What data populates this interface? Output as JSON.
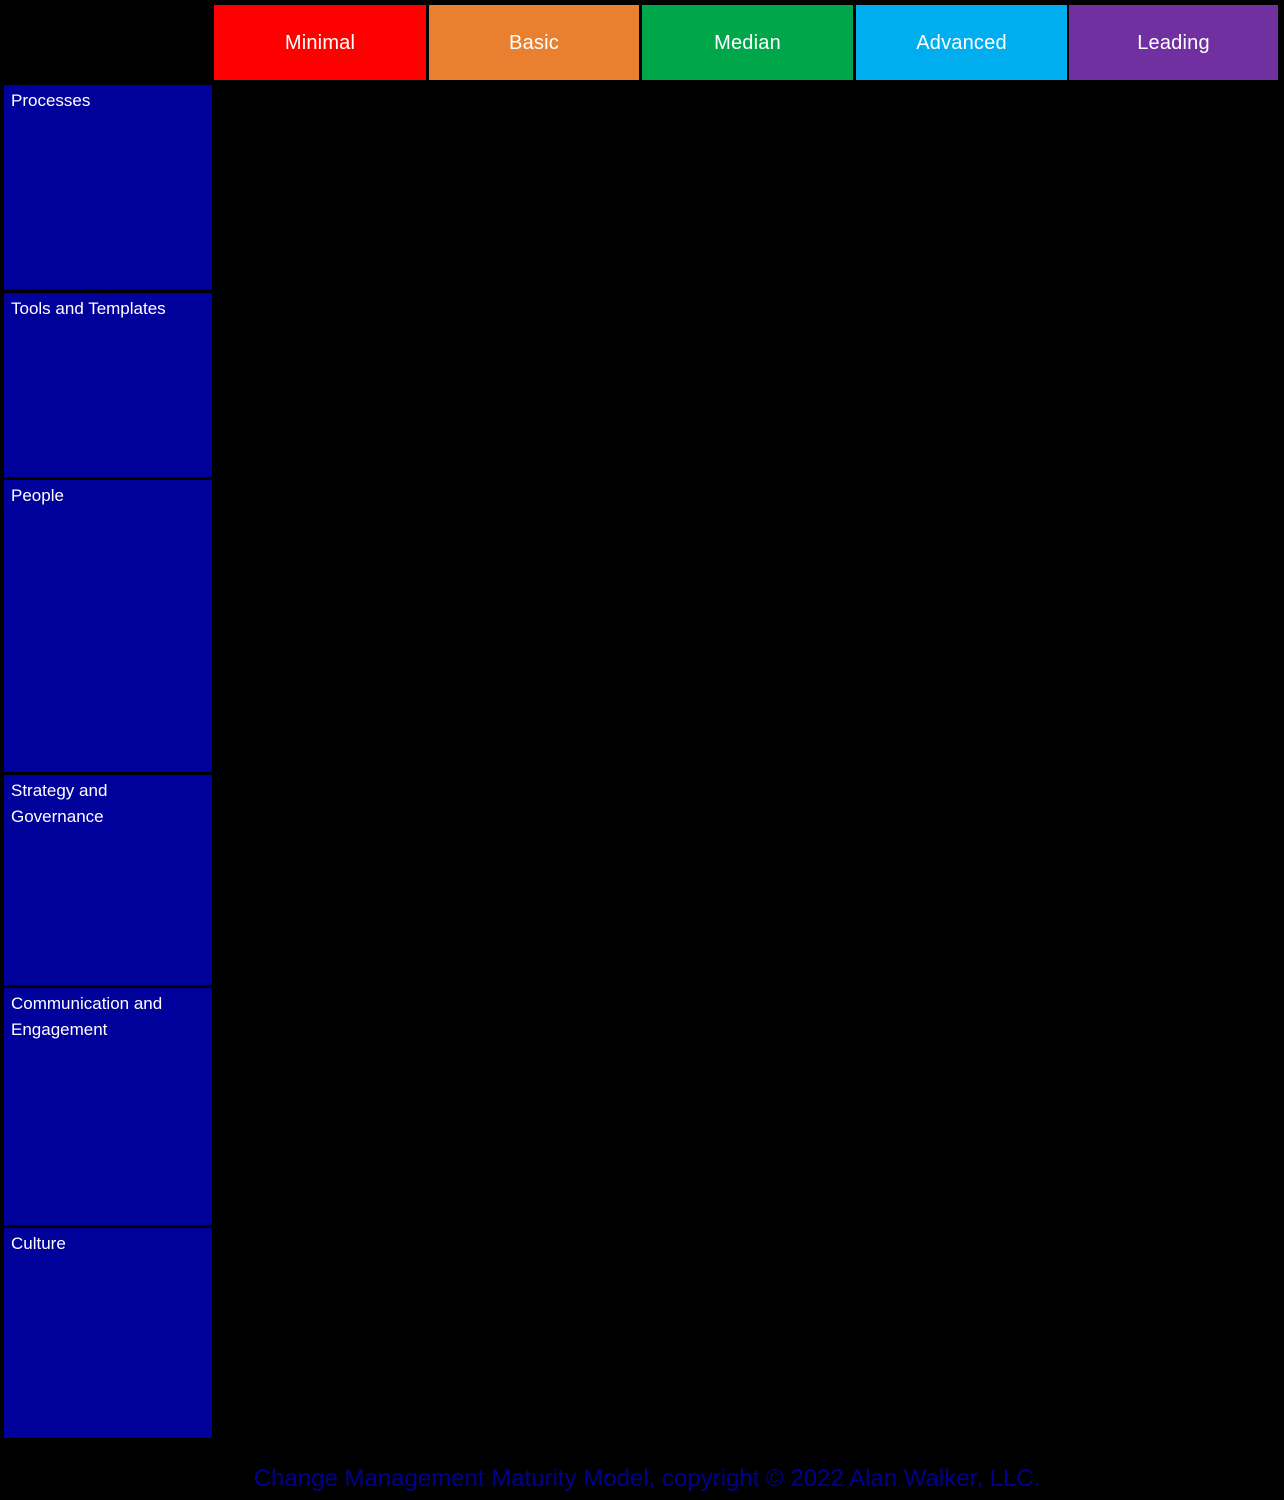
{
  "title": "Change Management Maturity Model",
  "background_color": "#000000",
  "columns": [
    {
      "label": "Minimal",
      "color": "#FF0000"
    },
    {
      "label": "Basic",
      "color": "#E8802F"
    },
    {
      "label": "Median",
      "color": "#00A74A"
    },
    {
      "label": "Advanced",
      "color": "#00AEEF"
    },
    {
      "label": "Leading",
      "color": "#7030A0"
    }
  ],
  "rows": [
    {
      "label": "Processes",
      "color": "#00009B"
    },
    {
      "label": "Tools and Templates",
      "color": "#00009B"
    },
    {
      "label": "People",
      "color": "#00009B"
    },
    {
      "label": "Strategy and\nGovernance",
      "color": "#00009B"
    },
    {
      "label": "Communication and\nEngagement",
      "color": "#00009B"
    },
    {
      "label": "Culture",
      "color": "#00009B"
    }
  ],
  "cells": [
    [
      "",
      "",
      "",
      "",
      ""
    ],
    [
      "",
      "",
      "",
      "",
      ""
    ],
    [
      "",
      "",
      "",
      "",
      ""
    ],
    [
      "",
      "",
      "",
      "",
      ""
    ],
    [
      "",
      "",
      "",
      "",
      ""
    ],
    [
      "",
      "",
      "",
      "",
      ""
    ]
  ],
  "footer": {
    "text": "Change Management Maturity Model, copyright © 2022 Alan Walker, LLC.",
    "color": "#00008f"
  }
}
